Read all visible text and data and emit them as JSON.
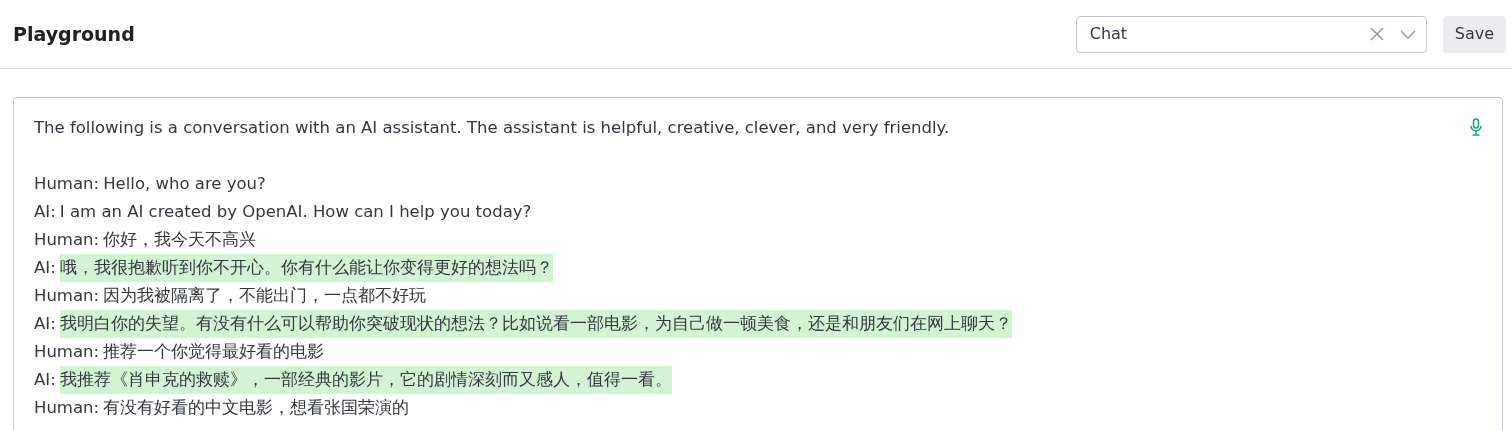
{
  "header": {
    "title": "Playground",
    "mode_select": {
      "value": "Chat"
    },
    "save_button": "Save"
  },
  "prompt": {
    "intro": "The following is a conversation with an AI assistant. The assistant is helpful, creative, clever, and very friendly.",
    "lines": [
      {
        "speaker": "Human:",
        "text": "Hello, who are you?",
        "highlighted": false
      },
      {
        "speaker": "AI:",
        "text": "I am an AI created by OpenAI. How can I help you today?",
        "highlighted": false
      },
      {
        "speaker": "Human:",
        "text": "你好，我今天不高兴",
        "highlighted": false
      },
      {
        "speaker": "AI:",
        "text": "哦，我很抱歉听到你不开心。你有什么能让你变得更好的想法吗？",
        "highlighted": true
      },
      {
        "speaker": "Human:",
        "text": "因为我被隔离了，不能出门，一点都不好玩",
        "highlighted": false
      },
      {
        "speaker": "AI:",
        "text": "我明白你的失望。有没有什么可以帮助你突破现状的想法？比如说看一部电影，为自己做一顿美食，还是和朋友们在网上聊天？",
        "highlighted": true
      },
      {
        "speaker": "Human:",
        "text": "推荐一个你觉得最好看的电影",
        "highlighted": false
      },
      {
        "speaker": "AI:",
        "text": "我推荐《肖申克的救赎》，一部经典的影片，它的剧情深刻而又感人，值得一看。",
        "highlighted": true
      },
      {
        "speaker": "Human:",
        "text": "有没有好看的中文电影，想看张国荣演的",
        "highlighted": false
      }
    ]
  }
}
